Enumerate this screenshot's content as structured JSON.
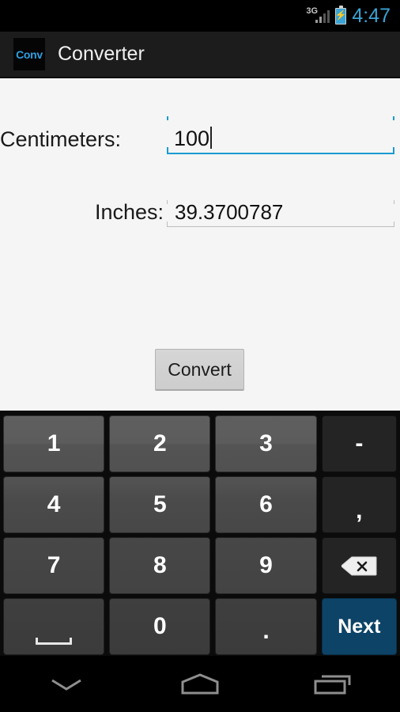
{
  "status_bar": {
    "network": "3G",
    "signal_icon": "signal-bars-icon",
    "battery_icon": "battery-charging-icon",
    "clock": "4:47",
    "accent_color": "#3aa3d4"
  },
  "action_bar": {
    "app_icon_label": "Conv",
    "app_icon_name": "app-logo-icon",
    "title": "Converter",
    "background": "#1c1c1c"
  },
  "form": {
    "fields": [
      {
        "label": "Centimeters:",
        "value": "100",
        "placeholder": "",
        "focused": true,
        "underline_color": "#1a9bd0",
        "name": "centimeters"
      },
      {
        "label": "Inches:",
        "value": "39.3700787",
        "placeholder": "",
        "focused": false,
        "underline_color": "#bdbdbd",
        "name": "inches"
      }
    ],
    "convert_label": "Convert",
    "background": "#f5f5f5"
  },
  "keyboard": {
    "type": "numeric",
    "rows": [
      [
        {
          "label": "1",
          "name": "key-1",
          "style": "num light"
        },
        {
          "label": "2",
          "name": "key-2",
          "style": "num light"
        },
        {
          "label": "3",
          "name": "key-3",
          "style": "num light"
        },
        {
          "label": "-",
          "name": "key-minus",
          "style": "side func"
        }
      ],
      [
        {
          "label": "4",
          "name": "key-4",
          "style": "num mid"
        },
        {
          "label": "5",
          "name": "key-5",
          "style": "num mid"
        },
        {
          "label": "6",
          "name": "key-6",
          "style": "num mid"
        },
        {
          "label": ",",
          "name": "key-comma",
          "style": "side func punct"
        }
      ],
      [
        {
          "label": "7",
          "name": "key-7",
          "style": "num dark"
        },
        {
          "label": "8",
          "name": "key-8",
          "style": "num dark"
        },
        {
          "label": "9",
          "name": "key-9",
          "style": "num dark"
        },
        {
          "label": "",
          "name": "key-backspace",
          "style": "side func backspace"
        }
      ],
      [
        {
          "label": "",
          "name": "key-space",
          "style": "num darker space"
        },
        {
          "label": "0",
          "name": "key-0",
          "style": "num darker"
        },
        {
          "label": ".",
          "name": "key-period",
          "style": "num darker dot"
        },
        {
          "label": "Next",
          "name": "key-next",
          "style": "side next"
        }
      ]
    ],
    "next_key_color": "#0d4366",
    "background": "#0b0b0b"
  },
  "nav_bar": {
    "buttons": [
      {
        "name": "hide-keyboard-icon",
        "icon": "chevron-down"
      },
      {
        "name": "home-icon",
        "icon": "home"
      },
      {
        "name": "recents-icon",
        "icon": "recents"
      }
    ],
    "background": "#000000"
  }
}
